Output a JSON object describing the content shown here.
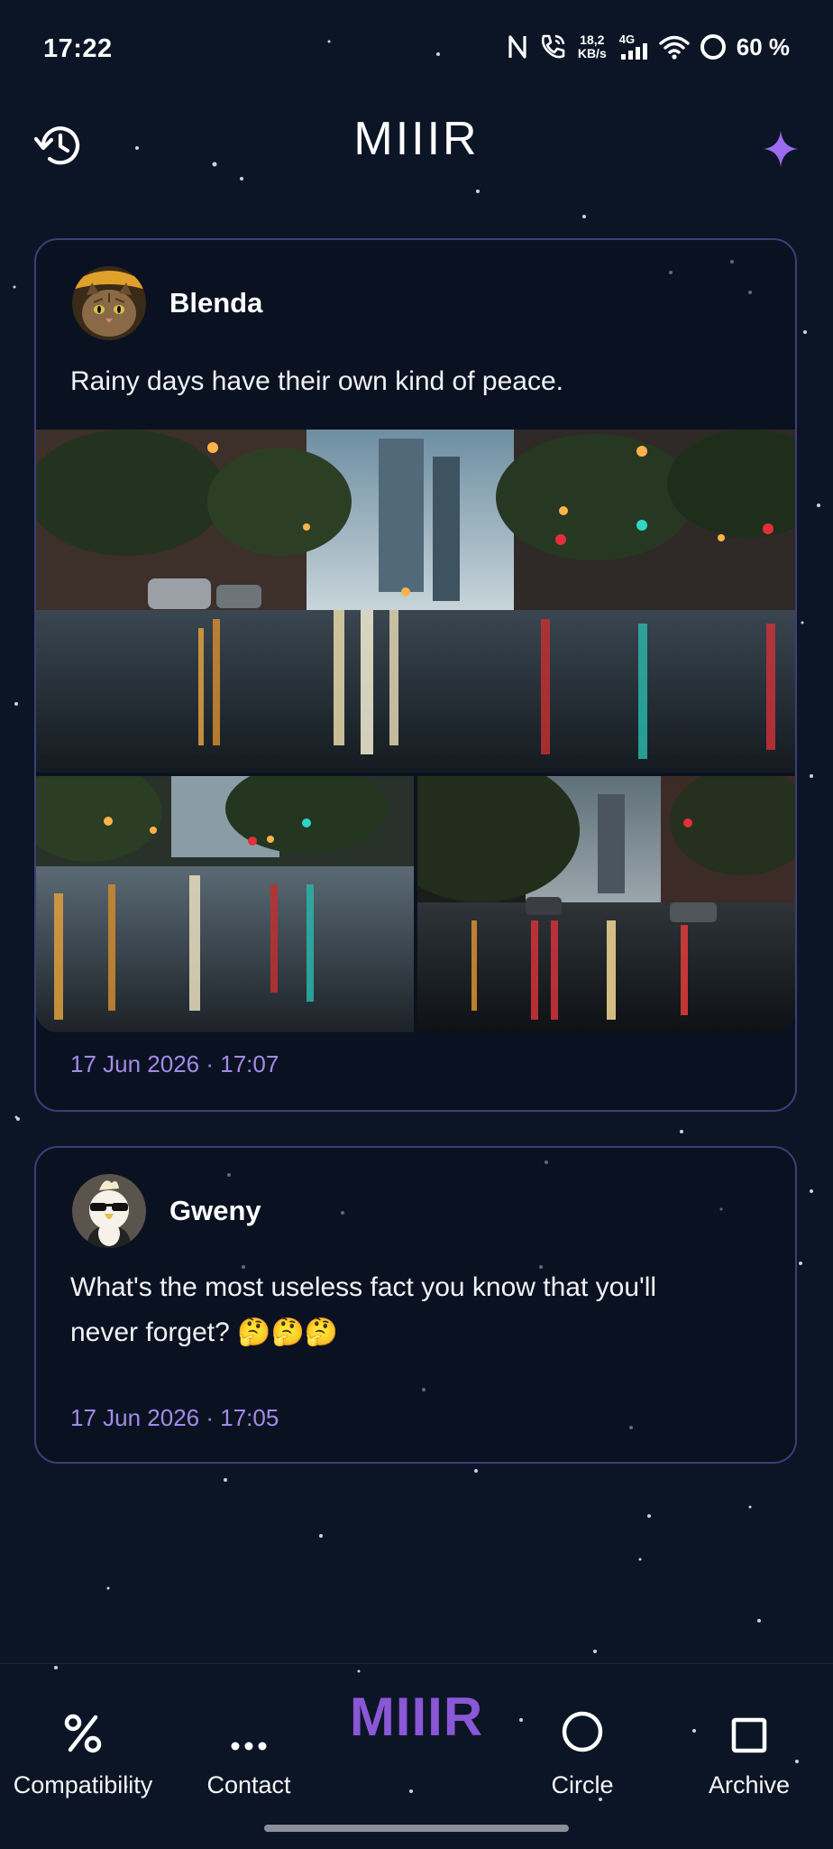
{
  "status_bar": {
    "time": "17:22",
    "net_speed_value": "18,2",
    "net_speed_unit": "KB/s",
    "network": "4G",
    "battery": "60 %"
  },
  "header": {
    "title": "MIIIR",
    "left_icon": "history-icon",
    "right_icon": "sparkle-icon"
  },
  "posts": [
    {
      "author": "Blenda",
      "avatar": "cat-with-yellow-hat-avatar",
      "text": "Rainy days have their own kind of peace.",
      "images": [
        "rainy-city-street-wide",
        "rainy-boulevard-left",
        "rainy-avenue-right"
      ],
      "date": "17 Jun 2026 · 17:07"
    },
    {
      "author": "Gweny",
      "avatar": "cockatoo-with-sunglasses-avatar",
      "text_line1": "What's the most useless fact you know that you'll",
      "text_line2": "never forget? 🤔🤔🤔",
      "date": "17 Jun 2026 · 17:05"
    }
  ],
  "nav": {
    "compatibility": "Compatibility",
    "contact": "Contact",
    "brand": "MIIIR",
    "circle": "Circle",
    "archive": "Archive"
  },
  "colors": {
    "background": "#0c1525",
    "card_border": "#3c3f78",
    "accent_purple": "#8a57d6",
    "date_purple": "#a48ae8",
    "sparkle": "#9b6cf2"
  }
}
